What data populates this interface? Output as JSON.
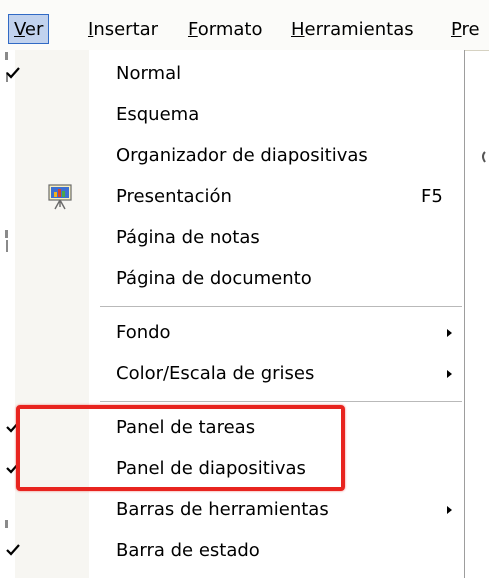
{
  "menubar": {
    "items": [
      {
        "label": "Ver",
        "active": true
      },
      {
        "label": "Insertar"
      },
      {
        "label": "Formato"
      },
      {
        "label": "Herramientas"
      },
      {
        "label": "Pre"
      }
    ]
  },
  "menu": {
    "items": [
      {
        "label": "Normal",
        "checked": true
      },
      {
        "label": "Esquema"
      },
      {
        "label": "Organizador de diapositivas"
      },
      {
        "label": "Presentación",
        "shortcut": "F5",
        "icon": "presentation-icon"
      },
      {
        "label": "Página de notas"
      },
      {
        "label": "Página de documento"
      },
      {
        "label": "Fondo",
        "submenu": true
      },
      {
        "label": "Color/Escala de grises",
        "submenu": true
      },
      {
        "label": "Panel de tareas",
        "checked": true
      },
      {
        "label": "Panel de diapositivas",
        "checked": true
      },
      {
        "label": "Barras de herramientas",
        "submenu": true
      },
      {
        "label": "Barra de estado",
        "checked": true
      }
    ]
  },
  "colors": {
    "highlight_box": "#e8241f",
    "active_menu_bg": "#c1d2ee",
    "active_menu_border": "#316ac5"
  }
}
